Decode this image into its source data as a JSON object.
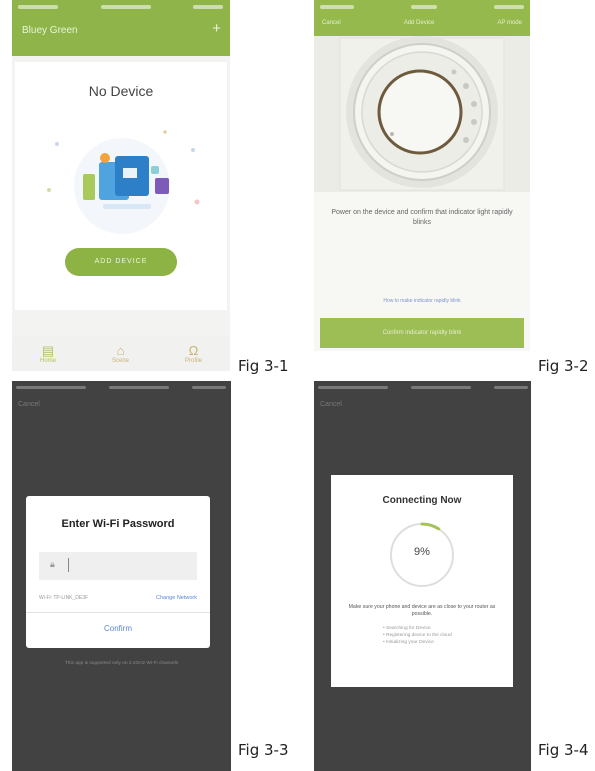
{
  "fig1": {
    "caption": "Fig 3-1",
    "header_title": "Bluey Green",
    "header_action": "+",
    "empty_title": "No Device",
    "add_button": "ADD DEVICE",
    "tabs": [
      {
        "label": "Home",
        "icon": "device-icon"
      },
      {
        "label": "Scene",
        "icon": "home-icon"
      },
      {
        "label": "Profile",
        "icon": "profile-icon"
      }
    ]
  },
  "fig2": {
    "caption": "Fig 3-2",
    "nav_back": "Cancel",
    "nav_title": "Add Device",
    "nav_right": "AP mode",
    "instruction": "Power on the device and confirm that indicator light rapidly blinks",
    "help_link": "How to make indicator rapidly blink",
    "confirm_button": "Confirm indicator rapidly blink"
  },
  "fig3": {
    "caption": "Fig 3-3",
    "cancel": "Cancel",
    "dialog_title": "Enter Wi-Fi Password",
    "password_placeholder": "",
    "ssid": "Wi-Fi: TP-LINK_DE3F",
    "change_network": "Change Network",
    "confirm": "Confirm",
    "note": "This app is supported only on 2.4GHz Wi-Fi channels"
  },
  "fig4": {
    "caption": "Fig 3-4",
    "cancel": "Cancel",
    "dialog_title": "Connecting Now",
    "progress_percent": 9,
    "progress_label": "9%",
    "message": "Make sure your phone and device are as close to your router as possible.",
    "steps": [
      "Searching for Device",
      "Registering device to the cloud",
      "Initializing your Device"
    ]
  },
  "colors": {
    "accent_green": "#8fb54a",
    "dark_bg": "#424242",
    "link_blue": "#5b86d4",
    "progress_green": "#a5c254"
  }
}
